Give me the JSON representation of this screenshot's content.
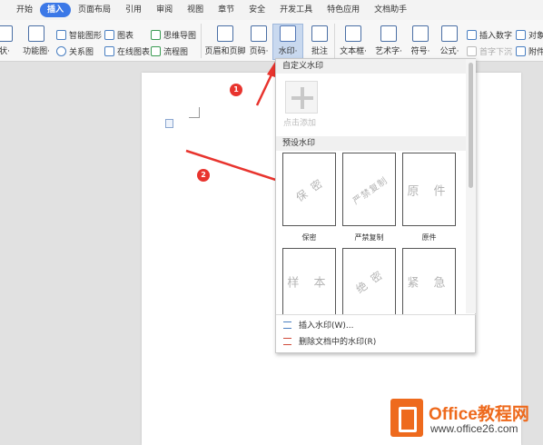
{
  "menubar": {
    "items": [
      "开始",
      "插入",
      "页面布局",
      "引用",
      "审阅",
      "视图",
      "章节",
      "安全",
      "开发工具",
      "特色应用",
      "文档助手"
    ],
    "active_index": 1
  },
  "toolbar": {
    "shape_label": "状·",
    "function_label": "功能图·",
    "smart_art": "智能图形",
    "chart": "图表",
    "mind_map": "思维导图",
    "relation": "关系图",
    "online_chart": "在线图表",
    "flowchart": "流程图",
    "header_footer": "页眉和页脚",
    "page_number": "页码·",
    "watermark": "水印·",
    "comment": "批注",
    "textbox": "文本框·",
    "art_text": "艺术字·",
    "symbol": "符号·",
    "formula": "公式·",
    "insert_number": "插入数字",
    "first_letter": "首字下沉",
    "object": "对象",
    "attachment": "附件"
  },
  "annotations": {
    "badge_1": "1",
    "badge_2": "2"
  },
  "colors": {
    "accent": "#3b78e7",
    "arrow": "#e8342e",
    "logo_orange": "#ee6a1d"
  },
  "watermark_panel": {
    "custom_header": "自定义水印",
    "add_label": "点击添加",
    "preset_header": "预设水印",
    "presets": [
      {
        "text": "保 密",
        "label": "保密",
        "style": "diagonal"
      },
      {
        "text": "严禁复制",
        "label": "严禁复制",
        "style": "diagonal"
      },
      {
        "text": "原 件",
        "label": "原件",
        "style": "flat"
      },
      {
        "text": "样 本",
        "label": "",
        "style": "flat"
      },
      {
        "text": "绝 密",
        "label": "",
        "style": "diagonal"
      },
      {
        "text": "紧 急",
        "label": "",
        "style": "flat"
      }
    ],
    "insert_action": "插入水印(W)...",
    "delete_action": "删除文档中的水印(R)"
  },
  "logo": {
    "title": "Office教程网",
    "url": "www.office26.com"
  }
}
